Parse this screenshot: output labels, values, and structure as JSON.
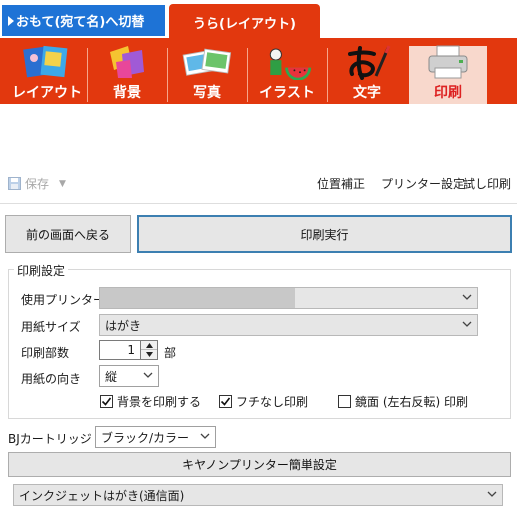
{
  "tabs": {
    "front_label": "おもて(宛て名)へ切替",
    "back_label": "うら(レイアウト)"
  },
  "categories": [
    {
      "label": "レイアウト",
      "icon": "layout-icon"
    },
    {
      "label": "背景",
      "icon": "background-icon"
    },
    {
      "label": "写真",
      "icon": "photo-icon"
    },
    {
      "label": "イラスト",
      "icon": "illustration-icon"
    },
    {
      "label": "文字",
      "icon": "text-brush-icon"
    },
    {
      "label": "印刷",
      "icon": "printer-icon",
      "active": true
    }
  ],
  "toolbar": {
    "save_label": "保存",
    "position_label": "位置補正",
    "printer_settings_label": "プリンター設定",
    "test_print_label": "試し印刷"
  },
  "buttons": {
    "back_label": "前の画面へ戻る",
    "print_label": "印刷実行"
  },
  "print_settings": {
    "title": "印刷設定",
    "printer_label": "使用プリンター",
    "printer_value": "",
    "paper_size_label": "用紙サイズ",
    "paper_size_value": "はがき",
    "copies_label": "印刷部数",
    "copies_value": "1",
    "copies_unit": "部",
    "orientation_label": "用紙の向き",
    "orientation_value": "縦",
    "print_background_label": "背景を印刷する",
    "print_background_checked": true,
    "borderless_label": "フチなし印刷",
    "borderless_checked": true,
    "mirror_label": "鏡面 (左右反転) 印刷",
    "mirror_checked": false
  },
  "bj": {
    "cartridge_label": "BJカートリッジ",
    "cartridge_value": "ブラック/カラー",
    "canon_setup_label": "キヤノンプリンター簡単設定",
    "media_value": "インクジェットはがき(通信面)"
  },
  "colors": {
    "accent_red": "#e2380e",
    "front_tab_blue": "#1e73d6",
    "active_tab_bg": "#f8d8cc"
  }
}
